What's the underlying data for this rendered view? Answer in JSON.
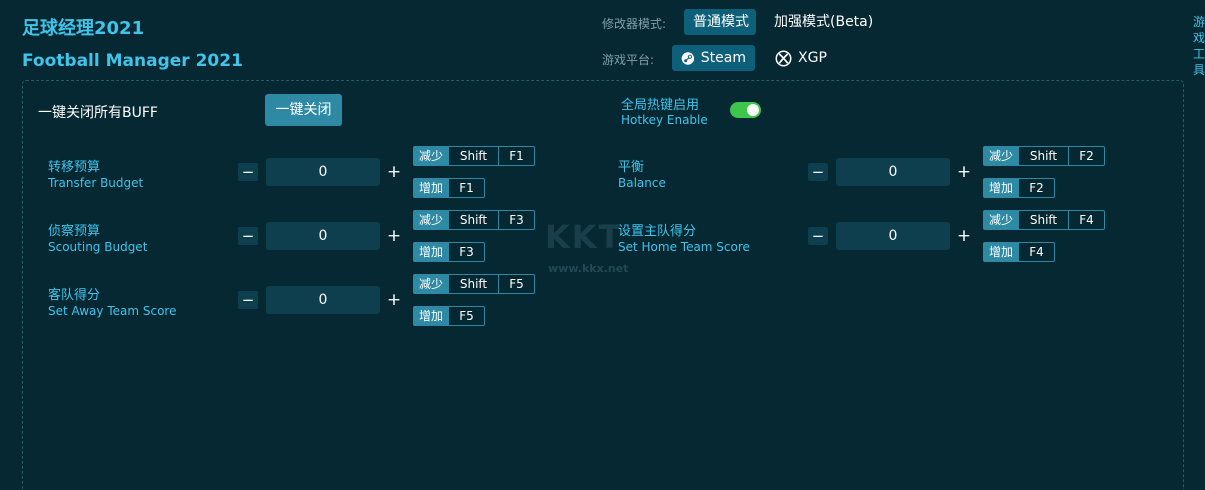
{
  "header": {
    "title_cn": "足球经理2021",
    "title_en": "Football Manager 2021",
    "mode_label": "修改器模式:",
    "mode_normal": "普通模式",
    "mode_beta": "加强模式(Beta)",
    "platform_label": "游戏平台:",
    "platform_steam": "Steam",
    "platform_xgp": "XGP",
    "side_text": "游戏工具"
  },
  "controls": {
    "close_all_label": "一键关闭所有BUFF",
    "close_all_button": "一键关闭",
    "hotkey_cn": "全局热键启用",
    "hotkey_en": "Hotkey Enable",
    "hotkey_enabled": true
  },
  "labels": {
    "decrease": "减少",
    "increase": "增加",
    "shift": "Shift",
    "minus": "−",
    "plus": "+"
  },
  "options": [
    {
      "cn": "转移预算",
      "en": "Transfer Budget",
      "value": "0",
      "dec_key": "F1",
      "inc_key": "F1"
    },
    {
      "cn": "侦察预算",
      "en": "Scouting Budget",
      "value": "0",
      "dec_key": "F3",
      "inc_key": "F3"
    },
    {
      "cn": "客队得分",
      "en": "Set Away Team Score",
      "value": "0",
      "dec_key": "F5",
      "inc_key": "F5"
    },
    {
      "cn": "平衡",
      "en": "Balance",
      "value": "0",
      "dec_key": "F2",
      "inc_key": "F2"
    },
    {
      "cn": "设置主队得分",
      "en": "Set Home Team Score",
      "value": "0",
      "dec_key": "F4",
      "inc_key": "F4"
    }
  ],
  "watermark": {
    "text": "KKT",
    "url": "www.kkx.net"
  },
  "colors": {
    "background": "#062833",
    "accent": "#3fc4ea",
    "button": "#2e89a5",
    "toggle_on": "#3dc54c"
  }
}
